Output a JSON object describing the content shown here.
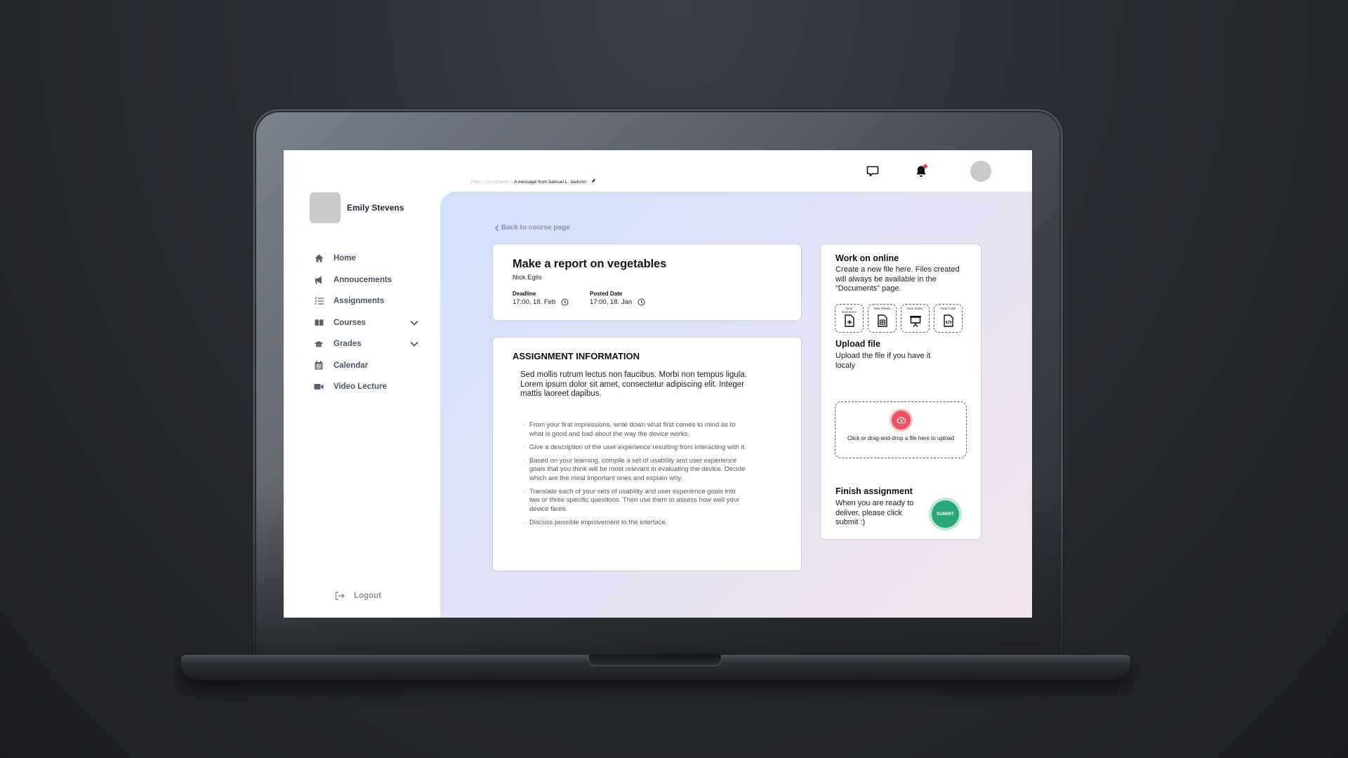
{
  "profile": {
    "name": "Emily Stevens"
  },
  "sidebar": {
    "items": [
      {
        "label": "Home",
        "icon": "home-icon",
        "has_chevron": false
      },
      {
        "label": "Annoucements",
        "icon": "megaphone-icon",
        "has_chevron": false
      },
      {
        "label": "Assignments",
        "icon": "checklist-icon",
        "has_chevron": false
      },
      {
        "label": "Courses",
        "icon": "book-icon",
        "has_chevron": true
      },
      {
        "label": "Grades",
        "icon": "graduation-cap-icon",
        "has_chevron": true
      },
      {
        "label": "Calendar",
        "icon": "calendar-icon",
        "has_chevron": false
      },
      {
        "label": "Video Lecture",
        "icon": "video-icon",
        "has_chevron": false
      }
    ],
    "logout_label": "Logout"
  },
  "breadcrumb": {
    "items": [
      "Files",
      "Documents"
    ],
    "separator": ">",
    "current": "A message from Samuel L. Jackson"
  },
  "topbar": {
    "notification_dot_color": "#ef4444"
  },
  "main": {
    "back_label": "Back to course page",
    "assignment": {
      "title": "Make a report on vegetables",
      "author": "Nick Eglis",
      "deadline_label": "Deadline",
      "deadline_value": "17:00, 18. Feb",
      "posted_label": "Posted Date",
      "posted_value": "17:00, 18. Jan"
    },
    "info": {
      "title": "ASSIGNMENT INFORMATION",
      "description": "Sed mollis rutrum lectus non faucibus. Morbi non tempus ligula. Lorem ipsum dolor sit amet, consectetur adipiscing elit. Integer mattis laoreet dapibus.",
      "bullets": [
        "From your first impressions, write down what first comes to mind as to what is good and bad about the way the device works.",
        "Give a description of the user experience resulting from interacting with it.",
        "Based on your learning, compile a set of usability and user experience goals that you think will be most relevant in evaluating the device. Decide which are the most important ones and explain why.",
        "Translate each of your sets of usability and user experience goals into two or three specific questions. Then use them to assess how well your device fares.",
        "Discuss possible improvement to the interface."
      ]
    },
    "side": {
      "online_title": "Work on online",
      "online_text": "Create a new file here. Files created will always be available in the “Documents” page.",
      "new_files": [
        {
          "label": "New Document",
          "icon": "new-document-icon"
        },
        {
          "label": "New Sheets",
          "icon": "new-sheet-icon"
        },
        {
          "label": "New Slides",
          "icon": "new-slides-icon"
        },
        {
          "label": "New Code",
          "icon": "new-code-icon"
        }
      ],
      "upload_title": "Upload file",
      "upload_text": "Upload the file if you have it localy",
      "upload_zone_text": "Click or drag-and-drop a file here to upload",
      "finish_title": "Finish assignment",
      "finish_text": "When you are ready to deliver, please click submit :)",
      "submit_label": "SUBMIT"
    }
  },
  "colors": {
    "upload_accent": "#ef5260",
    "submit_accent": "#28a878",
    "panel_gradient_start": "#d2e0fb",
    "panel_gradient_end": "#f4e6ee"
  }
}
